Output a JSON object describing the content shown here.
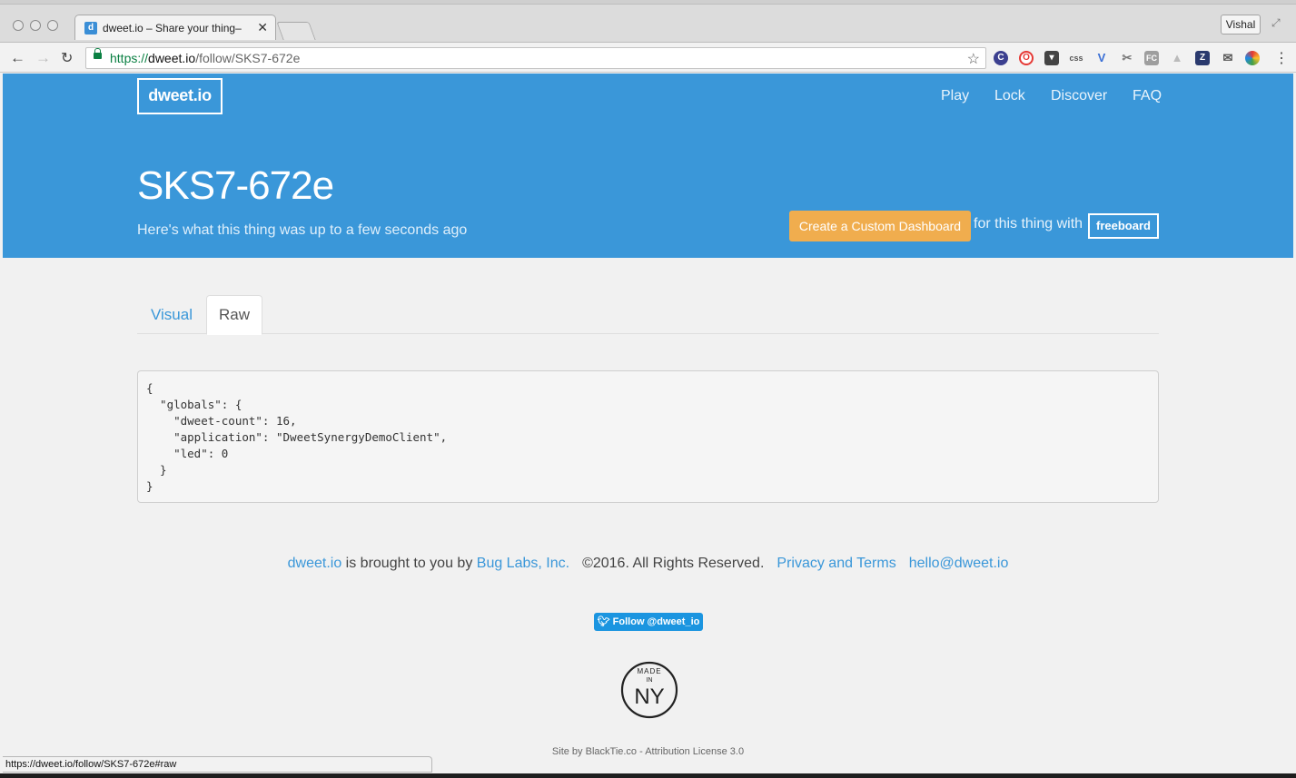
{
  "browser": {
    "tab_title": "dweet.io – Share your thing–",
    "tab_favicon": "d",
    "url_scheme": "https://",
    "url_host": "dweet.io",
    "url_path": "/follow/SKS7-672e",
    "user_name": "Vishal",
    "status_url": "https://dweet.io/follow/SKS7-672e#raw",
    "extensions": [
      "chromecast-icon",
      "opera-icon",
      "pocket-icon",
      "css-icon",
      "vue-icon",
      "scissors-icon",
      "fc-icon",
      "drive-icon",
      "zotero-icon",
      "mail-icon",
      "color-wheel-icon"
    ]
  },
  "header": {
    "logo": "dweet.io",
    "nav": [
      "Play",
      "Lock",
      "Discover",
      "FAQ"
    ],
    "thing_name": "SKS7-672e",
    "subtitle": "Here's what this thing was up to a few seconds ago",
    "dashboard_button": "Create a Custom Dashboard",
    "for_text": "for this thing with",
    "freeboard_button": "freeboard",
    "accent_color": "#3a97d9",
    "button_color": "#f0ad4e"
  },
  "tabs": {
    "visual": "Visual",
    "raw": "Raw",
    "active": "Raw"
  },
  "raw_json": "{\n  \"globals\": {\n    \"dweet-count\": 16,\n    \"application\": \"DweetSynergyDemoClient\",\n    \"led\": 0\n  }\n}",
  "footer": {
    "brand_link": "dweet.io",
    "brought_text": " is brought to you by ",
    "company_link": "Bug Labs, Inc.",
    "copyright": "©2016. All Rights Reserved.",
    "privacy_link": "Privacy and Terms",
    "email_link": "hello@dweet.io",
    "twitter_button": "Follow @dweet_io",
    "badge_top": "MADE",
    "badge_mid": "IN",
    "badge_bottom": "NY",
    "site_by": "Site by BlackTie.co - Attribution License 3.0"
  }
}
